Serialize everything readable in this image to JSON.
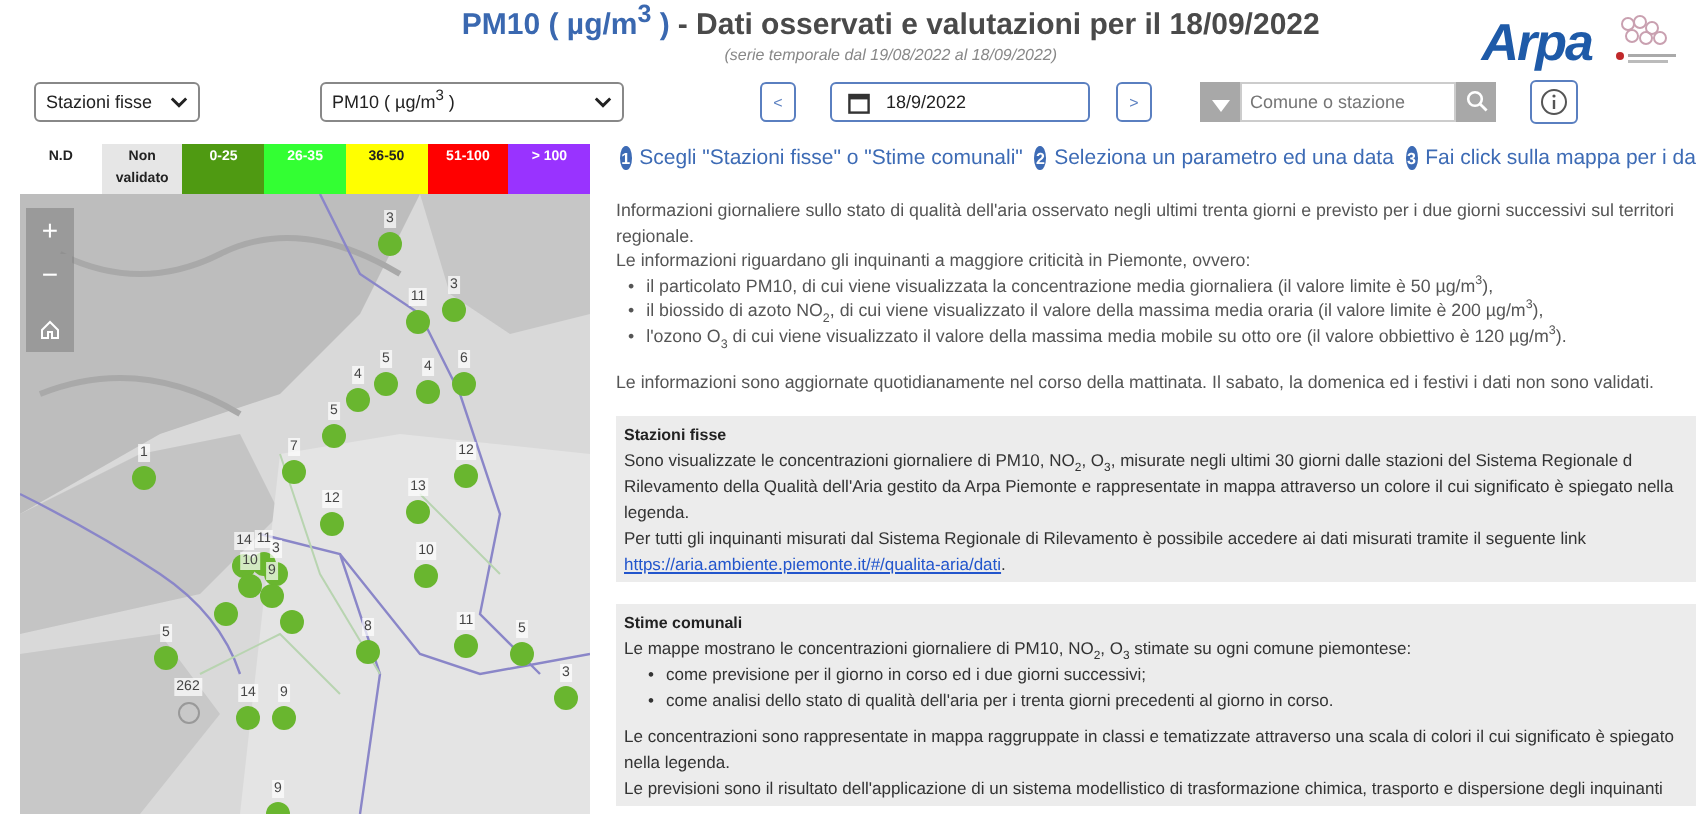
{
  "header": {
    "title_parameter": "PM10 ( µg/m$^{3}$ )",
    "title_text": "- Dati osservati e valutazioni per il 18/09/2022",
    "subtitle": "(serie temporale dal 19/08/2022 al 18/09/2022)",
    "logo": "Arpa"
  },
  "toolbar": {
    "mode_select": "Stazioni fisse",
    "parameter_select": "PM10 ( µg/m$^{3}$ )",
    "prev_button": "<",
    "date": "18/9/2022",
    "next_button": ">",
    "search": {
      "placeholder": "Comune o stazione"
    }
  },
  "legend": [
    {
      "label": "N.D",
      "color": "#ffffff"
    },
    {
      "label": "Non validato",
      "color": "#e6e6e6"
    },
    {
      "label": "0-25",
      "color": "#4f9a12"
    },
    {
      "label": "26-35",
      "color": "#33ff33"
    },
    {
      "label": "36-50",
      "color": "#ffff00"
    },
    {
      "label": "51-100",
      "color": "#ff0000"
    },
    {
      "label": "> 100",
      "color": "#9933ff"
    }
  ],
  "map": {
    "zoom_in": "+",
    "zoom_out": "−",
    "markers": [
      {
        "label": "3",
        "kind": "value"
      },
      {
        "label": "11",
        "kind": "value"
      },
      {
        "label": "3",
        "kind": "value"
      },
      {
        "label": "4",
        "kind": "value"
      },
      {
        "label": "5",
        "kind": "value"
      },
      {
        "label": "4",
        "kind": "value"
      },
      {
        "label": "6",
        "kind": "value"
      },
      {
        "label": "5",
        "kind": "value"
      },
      {
        "label": "1",
        "kind": "value"
      },
      {
        "label": "7",
        "kind": "value"
      },
      {
        "label": "12",
        "kind": "value"
      },
      {
        "label": "12",
        "kind": "value"
      },
      {
        "label": "13",
        "kind": "value"
      },
      {
        "label": "14",
        "kind": "value"
      },
      {
        "label": "11",
        "kind": "value"
      },
      {
        "label": "3",
        "kind": "value"
      },
      {
        "label": "10",
        "kind": "value"
      },
      {
        "label": "10",
        "kind": "value"
      },
      {
        "label": "9",
        "kind": "value"
      },
      {
        "label": "5",
        "kind": "value"
      },
      {
        "label": "8",
        "kind": "value"
      },
      {
        "label": "11",
        "kind": "value"
      },
      {
        "label": "5",
        "kind": "value"
      },
      {
        "label": "262",
        "kind": "nd"
      },
      {
        "label": "14",
        "kind": "value"
      },
      {
        "label": "9",
        "kind": "value"
      },
      {
        "label": "3",
        "kind": "value"
      },
      {
        "label": "9",
        "kind": "value"
      }
    ]
  },
  "steps": [
    {
      "number": "1",
      "text": "Scegli \"Stazioni fisse\" o \"Stime comunali\""
    },
    {
      "number": "2",
      "text": "Seleziona un parametro ed una data"
    },
    {
      "number": "3",
      "text": "Fai click sulla mappa per i da"
    }
  ],
  "intro": {
    "paragraph_lines": [
      "Informazioni giornaliere sullo stato di qualità dell'aria osservato negli ultimi trenta giorni e previsto per i due giorni successivi sul territori",
      "regionale."
    ],
    "pollutants_intro": "Le informazioni riguardano gli inquinanti a maggiore criticità in Piemonte, ovvero:",
    "bullets": [
      {
        "marker": "•",
        "text": "il particolato PM10, di cui viene visualizzata la concentrazione media giornaliera (il valore limite è 50 µg/m$^{3}$),"
      },
      {
        "marker": "•",
        "text": "il biossido di azoto NO$_{2}$, di cui viene visualizzato il valore della massima media oraria (il valore limite è 200 µg/m$^{3}$),"
      },
      {
        "marker": "•",
        "text": "l'ozono O$_{3}$ di cui viene visualizzato il valore della massima media mobile su otto ore (il valore obbiettivo è 120 µg/m$^{3}$)."
      }
    ],
    "update_note": "Le informazioni sono aggiornate quotidianamente nel corso della mattinata. Il sabato, la domenica ed i festivi i dati non sono validati."
  },
  "sections": [
    {
      "title": "Stazioni fisse",
      "blocks": [
        {
          "kind": "paragraph",
          "lines": [
            "Sono visualizzate le concentrazioni giornaliere di PM10, NO$_{2}$, O$_{3}$, misurate negli ultimi 30 giorni dalle stazioni del Sistema Regionale d",
            "Rilevamento della Qualità dell'Aria gestito da Arpa Piemonte e rappresentate in mappa attraverso un colore il cui significato è spiegato nella",
            "legenda."
          ]
        },
        {
          "kind": "link_paragraph",
          "lines": [
            "Per tutti gli inquinanti misurati dal Sistema Regionale di Rilevamento è possibile accedere ai dati misurati tramite il seguente link"
          ],
          "link": "https://aria.ambiente.piemonte.it/#/qualita-aria/dati",
          "after_link": "."
        }
      ]
    },
    {
      "title": "Stime comunali",
      "blocks": [
        {
          "kind": "paragraph",
          "lines": [
            "Le mappe mostrano le concentrazioni giornaliere di PM10, NO$_{2}$, O$_{3}$ stimate su ogni comune piemontese:"
          ]
        },
        {
          "kind": "bullets",
          "items": [
            {
              "marker": "•",
              "text": "come previsione per il giorno in corso ed i due giorni successivi;"
            },
            {
              "marker": "•",
              "text": "come analisi dello stato di qualità dell'aria per i trenta giorni precedenti al giorno in corso."
            }
          ]
        },
        {
          "kind": "paragraph",
          "lines": [
            "Le concentrazioni sono rappresentate in mappa raggruppate in classi e tematizzate attraverso una scala di colori il cui significato è spiegato",
            "nella legenda."
          ]
        },
        {
          "kind": "paragraph",
          "lines": [
            "Le previsioni sono il risultato dell'applicazione di un sistema modellistico di trasformazione chimica, trasporto e dispersione degli inquinanti"
          ]
        }
      ]
    }
  ]
}
